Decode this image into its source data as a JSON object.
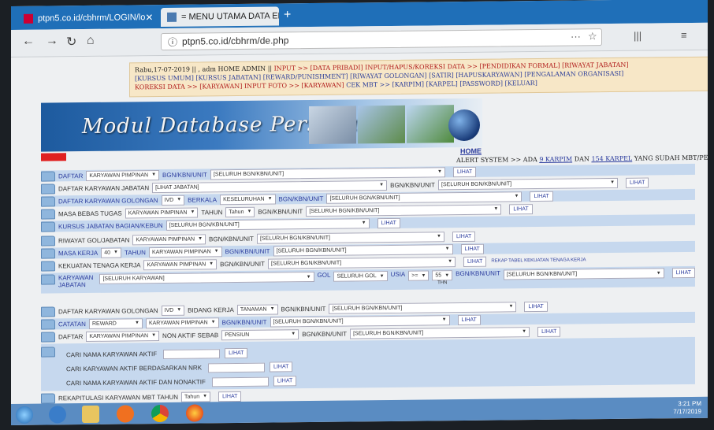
{
  "browser": {
    "tabs": [
      {
        "label": "ptpn5.co.id/cbhrm/LOGIN/lo"
      },
      {
        "label": "= MENU UTAMA DATA ENTRY"
      }
    ],
    "url": "ptpn5.co.id/cbhrm/de.php",
    "close_glyph": "✕",
    "new_tab_glyph": "+"
  },
  "header": {
    "line1": "Rabu,17-07-2019 || , adm HOME ADMIN ||",
    "nav_input": "INPUT >> [DATA PRIBADI]",
    "nav_input2": "INPUT/HAPUS/KOREKSI DATA >> [PENDIDIKAN FORMAL] [RIWAYAT JABATAN]",
    "line2": "[KURSUS UMUM] [KURSUS JABATAN] [REWARD/PUNISHMENT] [RIWAYAT GOLONGAN] [SATIR] [HAPUSKARYAWAN] [PENGALAMAN ORGANISASI]",
    "line3_a": "KOREKSI DATA >> [KARYAWAN]",
    "line3_b": "INPUT FOTO >> [KARYAWAN]",
    "line3_c": "CEK MBT >> [KARPIM] [KARPEL] [PASSWORD] [KELUAR]"
  },
  "banner": {
    "title": "Modul Database Personalia"
  },
  "home_link": "HOME",
  "alert": {
    "prefix": "ALERT SYSTEM >> ADA",
    "karpim": "9 KARPIM",
    "mid": "DAN",
    "karpel": "154 KARPEL",
    "suffix": "YANG SUDAH MBT/PENSIUN SILA"
  },
  "rows": {
    "r1": {
      "lbl": "DAFTAR",
      "sel1": "KARYAWAN PIMPINAN",
      "txt": "BGN/KBN/UNIT",
      "sel2": "[SELURUH BGN/KBN/UNIT]",
      "btn": "LIHAT"
    },
    "r2": {
      "lbl": "DAFTAR KARYAWAN JABATAN",
      "sel1": "[LIHAT JABATAN]",
      "txt": "BGN/KBN/UNIT",
      "sel2": "[SELURUH BGN/KBN/UNIT]",
      "btn": "LIHAT"
    },
    "r3": {
      "lbl": "DAFTAR KARYAWAN GOLONGAN",
      "sel1": "IVD",
      "txt": "BERKALA",
      "sel2": "KESELURUHAN",
      "txt2": "BGN/KBN/UNIT",
      "sel3": "[SELURUH BGN/KBN/UNIT]",
      "btn": "LIHAT"
    },
    "r4": {
      "lbl": "MASA BEBAS TUGAS",
      "sel1": "KARYAWAN PIMPINAN",
      "txt": "TAHUN",
      "sel2": "Tahun",
      "txt2": "BGN/KBN/UNIT",
      "sel3": "[SELURUH BGN/KBN/UNIT]",
      "btn": "LIHAT"
    },
    "r5": {
      "lbl": "KURSUS JABATAN BAGIAN/KEBUN",
      "sel1": "[SELURUH BGN/KBN/UNIT]",
      "btn": "LIHAT"
    },
    "r6": {
      "lbl": "RIWAYAT GOL/JABATAN",
      "sel1": "KARYAWAN PIMPINAN",
      "txt": "BGN/KBN/UNIT",
      "sel2": "[SELURUH BGN/KBN/UNIT]",
      "btn": "LIHAT"
    },
    "r7": {
      "lbl": "MASA KERJA",
      "sel1": "40",
      "txt": "TAHUN",
      "sel2": "KARYAWAN PIMPINAN",
      "txt2": "BGN/KBN/UNIT",
      "sel3": "[SELURUH BGN/KBN/UNIT]",
      "btn": "LIHAT"
    },
    "r8": {
      "lbl": "KEKUATAN TENAGA KERJA",
      "sel1": "KARYAWAN PIMPINAN",
      "txt": "BGN/KBN/UNIT",
      "sel2": "[SELURUH BGN/KBN/UNIT]",
      "btn": "LIHAT",
      "extra": "REKAP TABEL KEKUATAN TENAGA KERJA"
    },
    "r9": {
      "lbl": "KARYAWAN",
      "lbl2": "JABATAN",
      "sel1": "[SELURUH KARYAWAN]",
      "txt": "GOL",
      "sel2": "SELURUH GOL",
      "txt2": "USIA",
      "sel3": ">=",
      "sel4": "55",
      "thn": "THN",
      "txt3": "BGN/KBN/UNIT",
      "sel5": "[SELURUH BGN/KBN/UNIT]",
      "btn": "LIHAT"
    },
    "r10": {
      "lbl": "DAFTAR KARYAWAN GOLONGAN",
      "sel1": "IVD",
      "txt": "BIDANG KERJA",
      "sel2": "TANAMAN",
      "txt2": "BGN/KBN/UNIT",
      "sel3": "[SELURUH BGN/KBN/UNIT]",
      "btn": "LIHAT"
    },
    "r11": {
      "lbl": "CATATAN",
      "sel1": "REWARD",
      "sel2": "KARYAWAN PIMPINAN",
      "txt": "BGN/KBN/UNIT",
      "sel3": "[SELURUH BGN/KBN/UNIT]",
      "btn": "LIHAT"
    },
    "r12": {
      "lbl": "DAFTAR",
      "sel1": "KARYAWAN PIMPINAN",
      "txt": "NON AKTIF SEBAB",
      "sel2": "PENSIUN",
      "txt2": "BGN/KBN/UNIT",
      "sel3": "[SELURUH BGN/KBN/UNIT]",
      "btn": "LIHAT"
    }
  },
  "search": {
    "s1": {
      "label": "CARI NAMA KARYAWAN AKTIF",
      "btn": "LIHAT"
    },
    "s2": {
      "label": "CARI KARYAWAN AKTIF BERDASARKAN NRK",
      "btn": "LIHAT"
    },
    "s3": {
      "label": "CARI NAMA KARYAWAN AKTIF DAN NONAKTIF",
      "btn": "LIHAT"
    }
  },
  "rekap": {
    "lbl": "REKAPITULASI KARYAWAN MBT TAHUN",
    "sel1": "Tahun",
    "btn": "LIHAT"
  },
  "taskbar": {
    "time": "3:21 PM",
    "date": "7/17/2019"
  }
}
